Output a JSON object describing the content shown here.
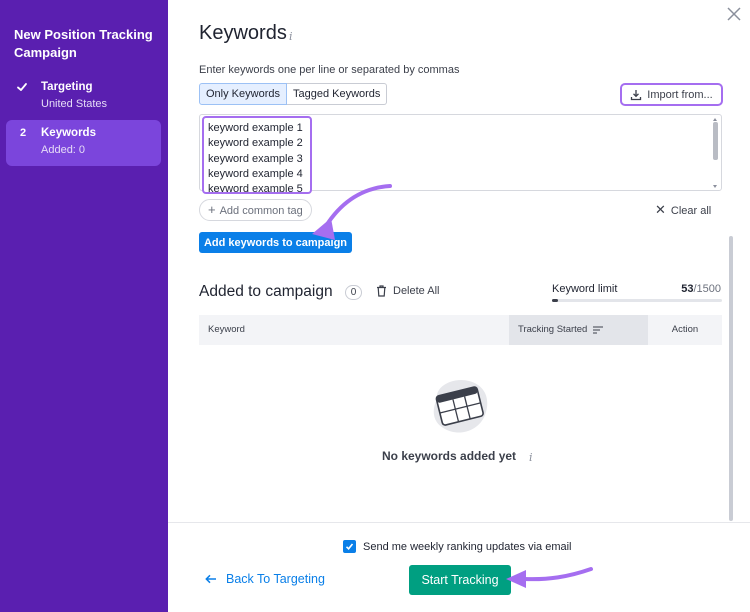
{
  "sidebar": {
    "title": "New Position Tracking Campaign",
    "steps": [
      {
        "mark": "check",
        "name": "Targeting",
        "sub": "United States"
      },
      {
        "mark": "2",
        "name": "Keywords",
        "sub": "Added: 0"
      }
    ]
  },
  "main": {
    "title": "Keywords",
    "info_glyph": "i",
    "hint": "Enter keywords one per line or separated by commas",
    "toggle": [
      "Only Keywords",
      "Tagged Keywords"
    ],
    "import_label": "Import from...",
    "keywords": [
      "keyword example 1",
      "keyword example 2",
      "keyword example 3",
      "keyword example 4",
      "keyword example 5"
    ],
    "common_tag_label": "Add common tag",
    "clear_all_label": "Clear all",
    "add_button_label": "Add keywords to campaign"
  },
  "campaign": {
    "title": "Added to campaign",
    "count": "0",
    "delete_all_label": "Delete All",
    "limit_label": "Keyword limit",
    "limit_used": "53",
    "limit_total": "/1500",
    "limit_fraction": 0.035,
    "columns": [
      "Keyword",
      "Tracking Started",
      "Action"
    ],
    "empty_text": "No keywords added yet"
  },
  "footer": {
    "email_label": "Send me weekly ranking updates via email",
    "email_checked": true,
    "back_label": "Back To Targeting",
    "start_label": "Start Tracking"
  },
  "colors": {
    "sidebar_bg": "#5a1fb0",
    "active_step": "#7b45dc",
    "primary_blue": "#0a7fe8",
    "start_green": "#009f81",
    "annotation_purple": "#a56ef0"
  }
}
